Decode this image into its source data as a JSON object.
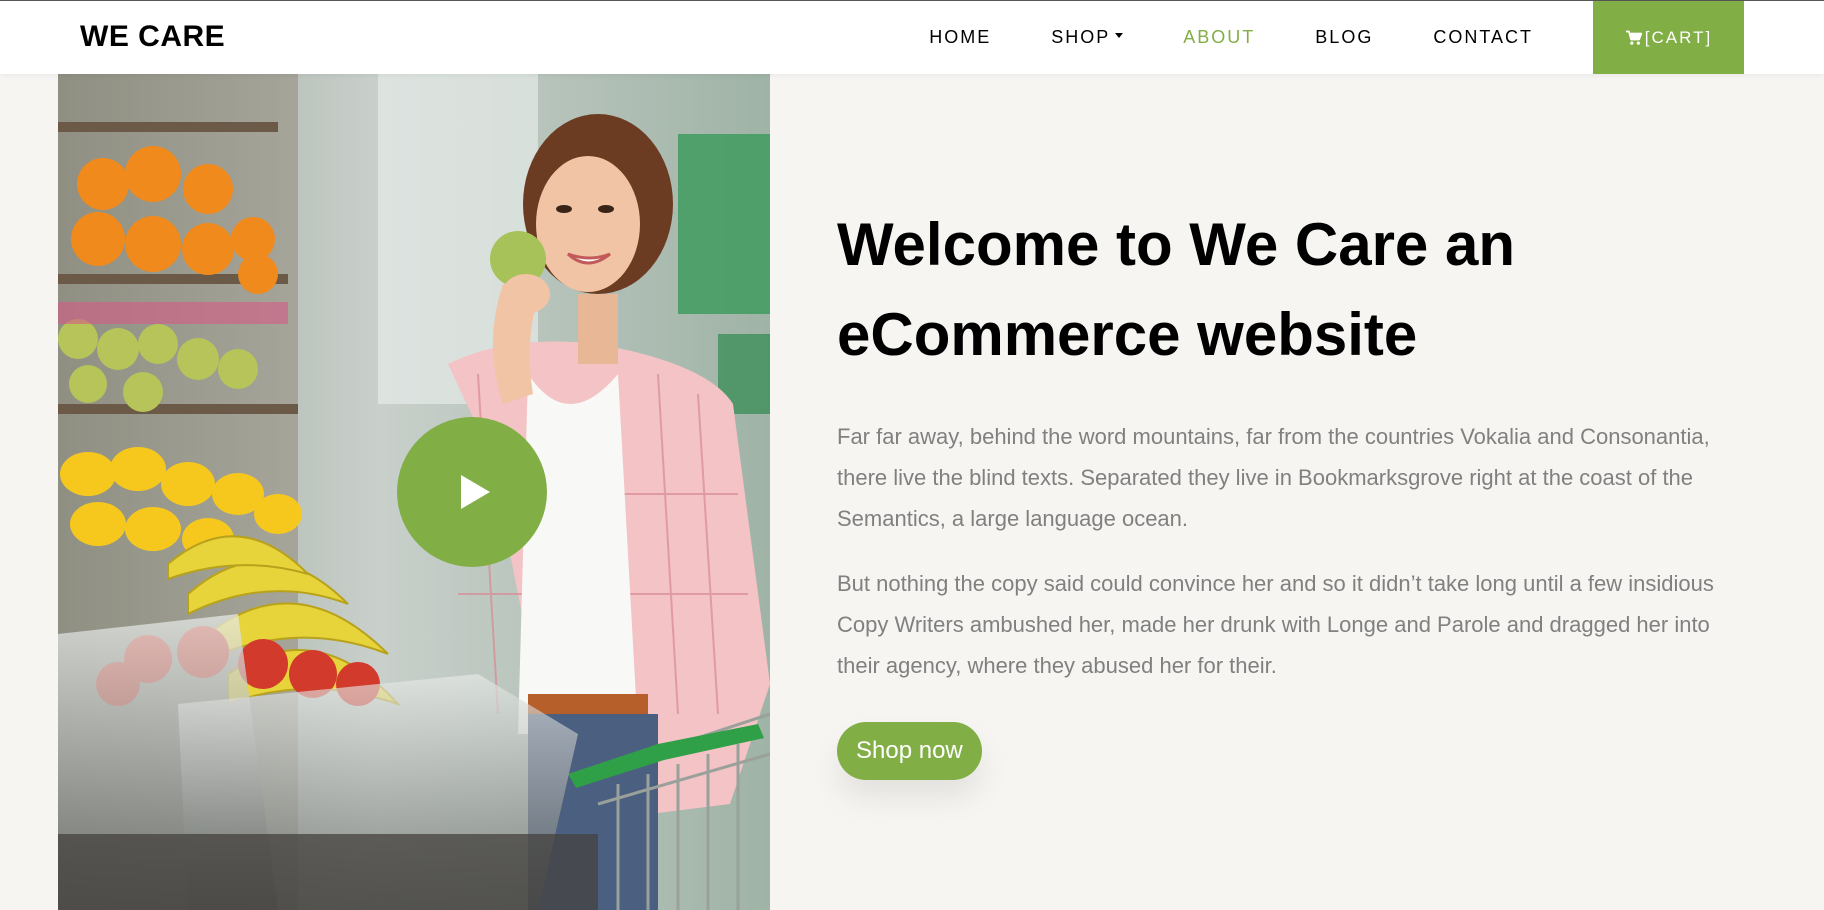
{
  "brand": "WE CARE",
  "nav": {
    "items": [
      {
        "label": "HOME"
      },
      {
        "label": "SHOP"
      },
      {
        "label": "ABOUT"
      },
      {
        "label": "BLOG"
      },
      {
        "label": "CONTACT"
      }
    ],
    "active": "ABOUT",
    "cart_label": "[CART]"
  },
  "hero": {
    "title": "Welcome to We Care an eCommerce website",
    "paragraphs": [
      "Far far away, behind the word mountains, far from the countries Vokalia and Consonantia, there live the blind texts. Separated they live in Bookmarksgrove right at the coast of the Semantics, a large language ocean.",
      "But nothing the copy said could convince her and so it didn’t take long until a few insidious Copy Writers ambushed her, made her drunk with Longe and Parole and dragged her into their agency, where they abused her for their."
    ],
    "cta_label": "Shop now",
    "image_icon": "play-icon"
  },
  "colors": {
    "accent": "#82ae46",
    "background": "#f6f5f2",
    "body_text": "#808080"
  }
}
